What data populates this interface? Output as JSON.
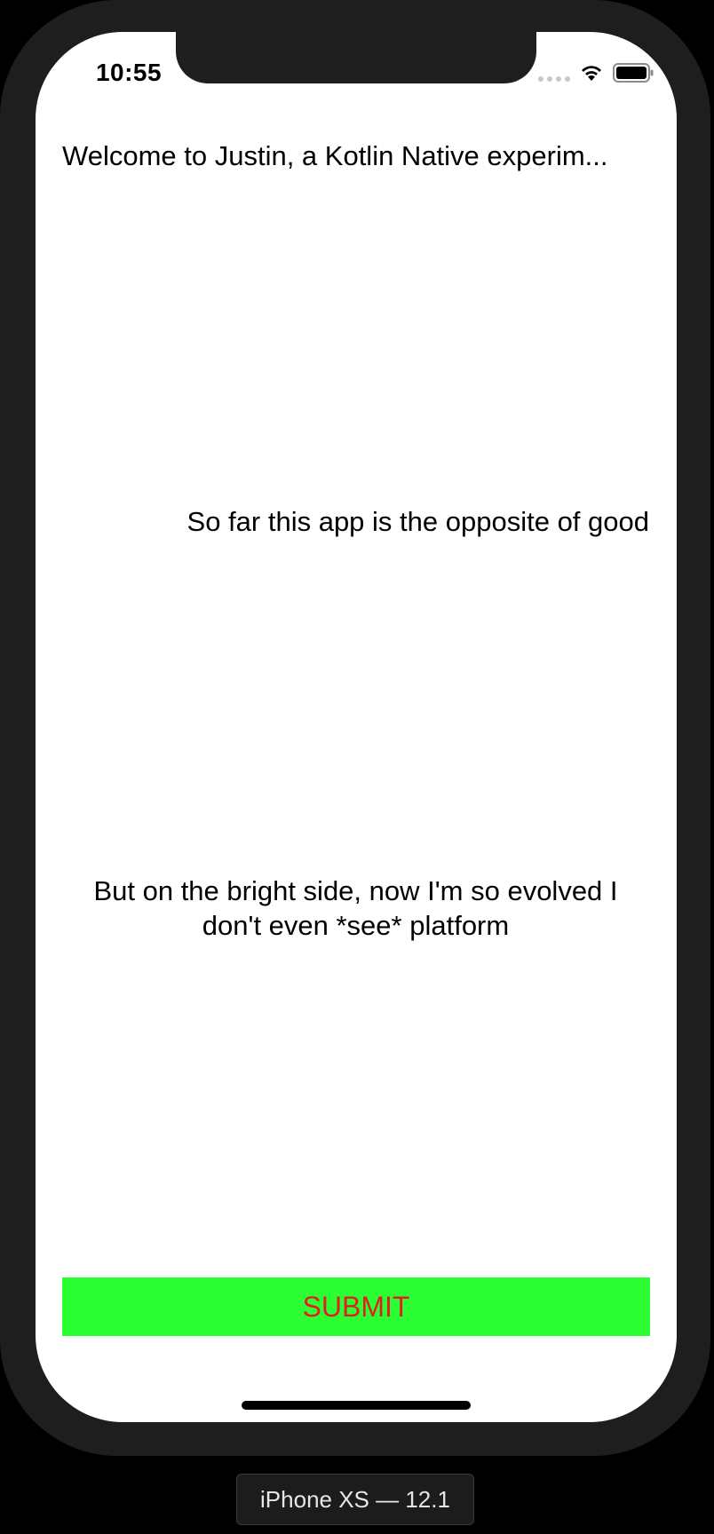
{
  "status_bar": {
    "time": "10:55",
    "icons": [
      "cellular-signal-icon",
      "wifi-icon",
      "battery-icon"
    ]
  },
  "content": {
    "welcome": "Welcome to Justin, a Kotlin Native experim...",
    "middle": "So far this app is the opposite of good",
    "bright_side": "But on the bright side, now I'm so evolved I don't even *see* platform"
  },
  "submit_button": {
    "label": "SUBMIT",
    "background_color": "#2bff33",
    "text_color": "#e02020"
  },
  "simulator": {
    "device_label": "iPhone XS — 12.1"
  }
}
